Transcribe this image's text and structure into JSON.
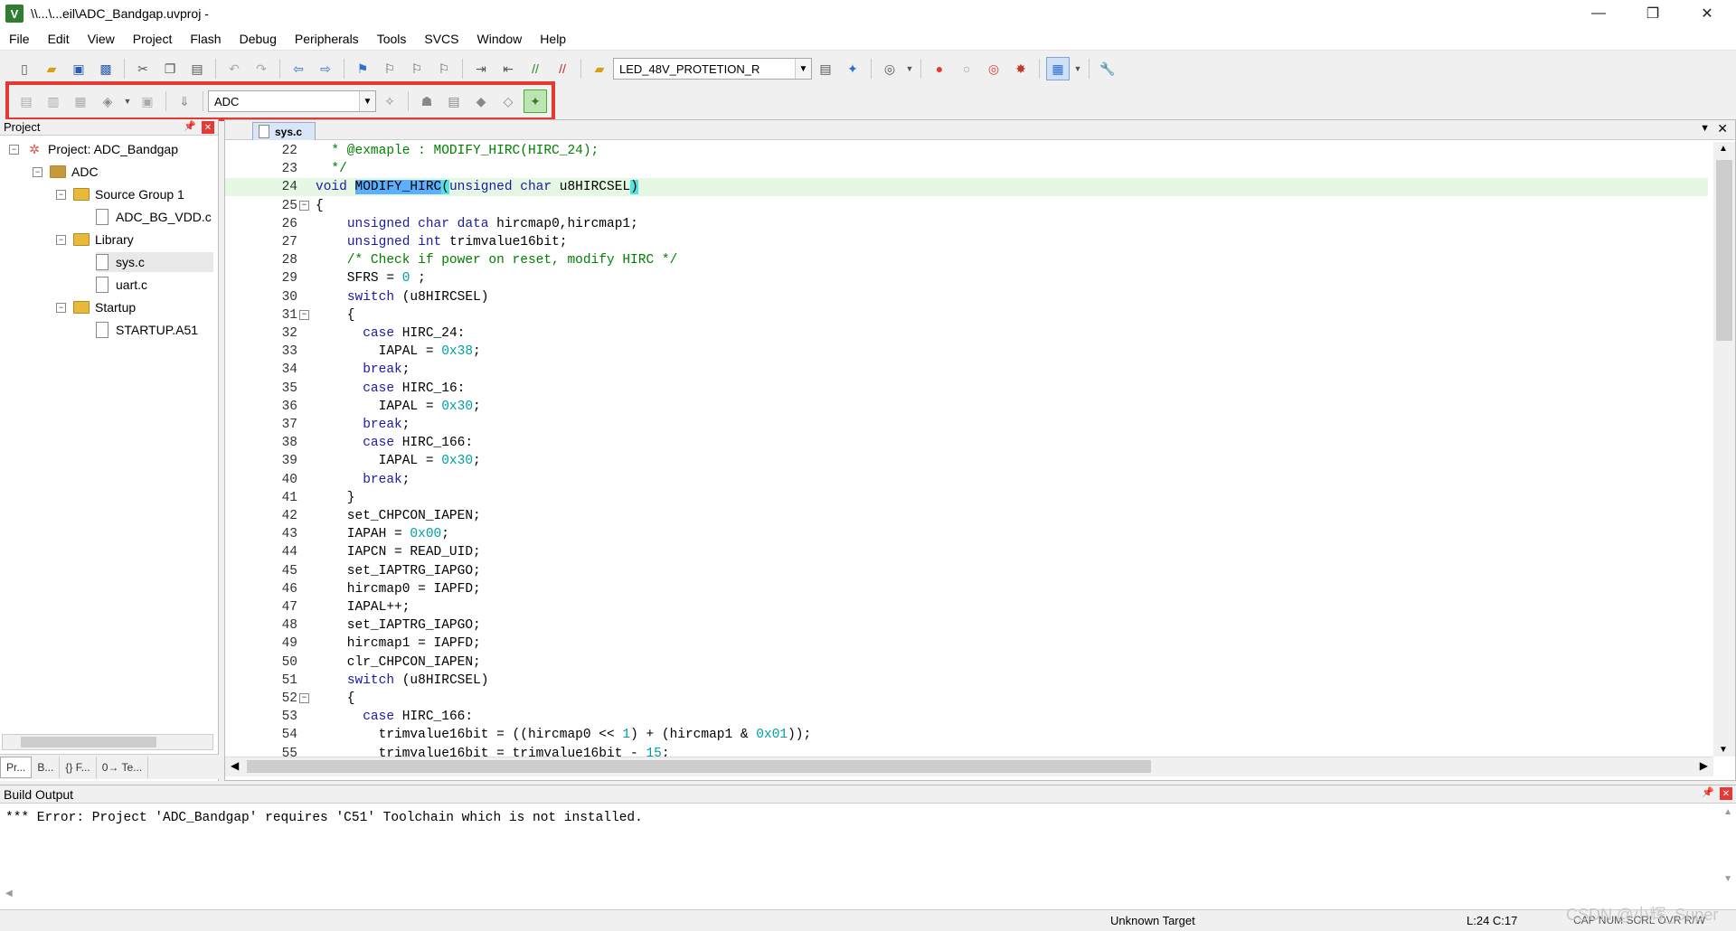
{
  "window": {
    "title": "\\\\...\\...eil\\ADC_Bandgap.uvproj -",
    "app_icon": "V",
    "minimize_glyph": "—",
    "restore_glyph": "❐",
    "close_glyph": "✕"
  },
  "menu": [
    "File",
    "Edit",
    "View",
    "Project",
    "Flash",
    "Debug",
    "Peripherals",
    "Tools",
    "SVCS",
    "Window",
    "Help"
  ],
  "toolbar1": {
    "target_combo": "LED_48V_PROTETION_R"
  },
  "toolbar2": {
    "target_select": "ADC"
  },
  "project_pane": {
    "title": "Project",
    "tree": [
      {
        "label": "Project: ADC_Bandgap",
        "kind": "project"
      },
      {
        "label": "ADC",
        "kind": "target"
      },
      {
        "label": "Source Group 1",
        "kind": "folder"
      },
      {
        "label": "ADC_BG_VDD.c",
        "kind": "file"
      },
      {
        "label": "Library",
        "kind": "folder"
      },
      {
        "label": "sys.c",
        "kind": "file"
      },
      {
        "label": "uart.c",
        "kind": "file"
      },
      {
        "label": "Startup",
        "kind": "folder"
      },
      {
        "label": "STARTUP.A51",
        "kind": "file"
      }
    ],
    "tabs": [
      "Pr...",
      "B...",
      "{} F...",
      "0→ Te..."
    ]
  },
  "editor": {
    "tab": "sys.c",
    "lines": [
      {
        "n": "22",
        "t": "  * @exmaple : MODIFY_HIRC(HIRC_24);"
      },
      {
        "n": "23",
        "t": "  */"
      },
      {
        "n": "24",
        "t": "void MODIFY_HIRC(unsigned char u8HIRCSEL)"
      },
      {
        "n": "25",
        "t": "{"
      },
      {
        "n": "26",
        "t": "    unsigned char data hircmap0,hircmap1;"
      },
      {
        "n": "27",
        "t": "    unsigned int trimvalue16bit;"
      },
      {
        "n": "28",
        "t": "    /* Check if power on reset, modify HIRC */"
      },
      {
        "n": "29",
        "t": "    SFRS = 0 ;"
      },
      {
        "n": "30",
        "t": "    switch (u8HIRCSEL)"
      },
      {
        "n": "31",
        "t": "    {"
      },
      {
        "n": "32",
        "t": "      case HIRC_24:"
      },
      {
        "n": "33",
        "t": "        IAPAL = 0x38;"
      },
      {
        "n": "34",
        "t": "      break;"
      },
      {
        "n": "35",
        "t": "      case HIRC_16:"
      },
      {
        "n": "36",
        "t": "        IAPAL = 0x30;"
      },
      {
        "n": "37",
        "t": "      break;"
      },
      {
        "n": "38",
        "t": "      case HIRC_166:"
      },
      {
        "n": "39",
        "t": "        IAPAL = 0x30;"
      },
      {
        "n": "40",
        "t": "      break;"
      },
      {
        "n": "41",
        "t": "    }"
      },
      {
        "n": "42",
        "t": "    set_CHPCON_IAPEN;"
      },
      {
        "n": "43",
        "t": "    IAPAH = 0x00;"
      },
      {
        "n": "44",
        "t": "    IAPCN = READ_UID;"
      },
      {
        "n": "45",
        "t": "    set_IAPTRG_IAPGO;"
      },
      {
        "n": "46",
        "t": "    hircmap0 = IAPFD;"
      },
      {
        "n": "47",
        "t": "    IAPAL++;"
      },
      {
        "n": "48",
        "t": "    set_IAPTRG_IAPGO;"
      },
      {
        "n": "49",
        "t": "    hircmap1 = IAPFD;"
      },
      {
        "n": "50",
        "t": "    clr_CHPCON_IAPEN;"
      },
      {
        "n": "51",
        "t": "    switch (u8HIRCSEL)"
      },
      {
        "n": "52",
        "t": "    {"
      },
      {
        "n": "53",
        "t": "      case HIRC_166:"
      },
      {
        "n": "54",
        "t": "        trimvalue16bit = ((hircmap0 << 1) + (hircmap1 & 0x01));"
      },
      {
        "n": "55",
        "t": "        trimvalue16bit = trimvalue16bit - 15;"
      }
    ]
  },
  "build_output": {
    "title": "Build Output",
    "message": "*** Error: Project 'ADC_Bandgap' requires 'C51' Toolchain which is not installed."
  },
  "status": {
    "target": "Unknown Target",
    "position": "L:24 C:17",
    "flags": "CAP  NUM  SCRL  OVR  R/W"
  },
  "watermark": "CSDN @小辉_Super",
  "colors": {
    "accent": "#e53935",
    "keyword": "#1a1aa6",
    "comment": "#008000",
    "number": "#00a0a0"
  }
}
